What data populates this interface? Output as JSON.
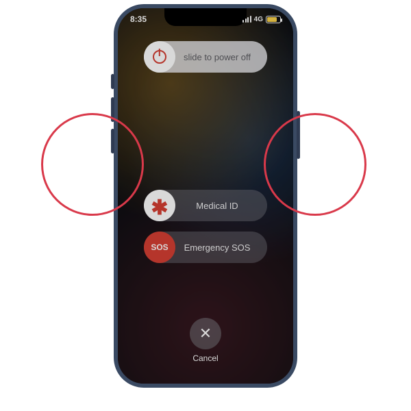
{
  "status_bar": {
    "time": "8:35",
    "network_label": "4G",
    "battery_color": "#ffd33d"
  },
  "sliders": {
    "power_off": {
      "label": "slide to power off",
      "icon_color": "#e23b2e"
    },
    "medical_id": {
      "label": "Medical ID",
      "knob_glyph": "✱"
    },
    "emergency_sos": {
      "label": "Emergency SOS",
      "knob_text": "SOS"
    }
  },
  "cancel": {
    "label": "Cancel",
    "glyph": "✕"
  },
  "annotation": {
    "circle_color": "#d9394a"
  }
}
